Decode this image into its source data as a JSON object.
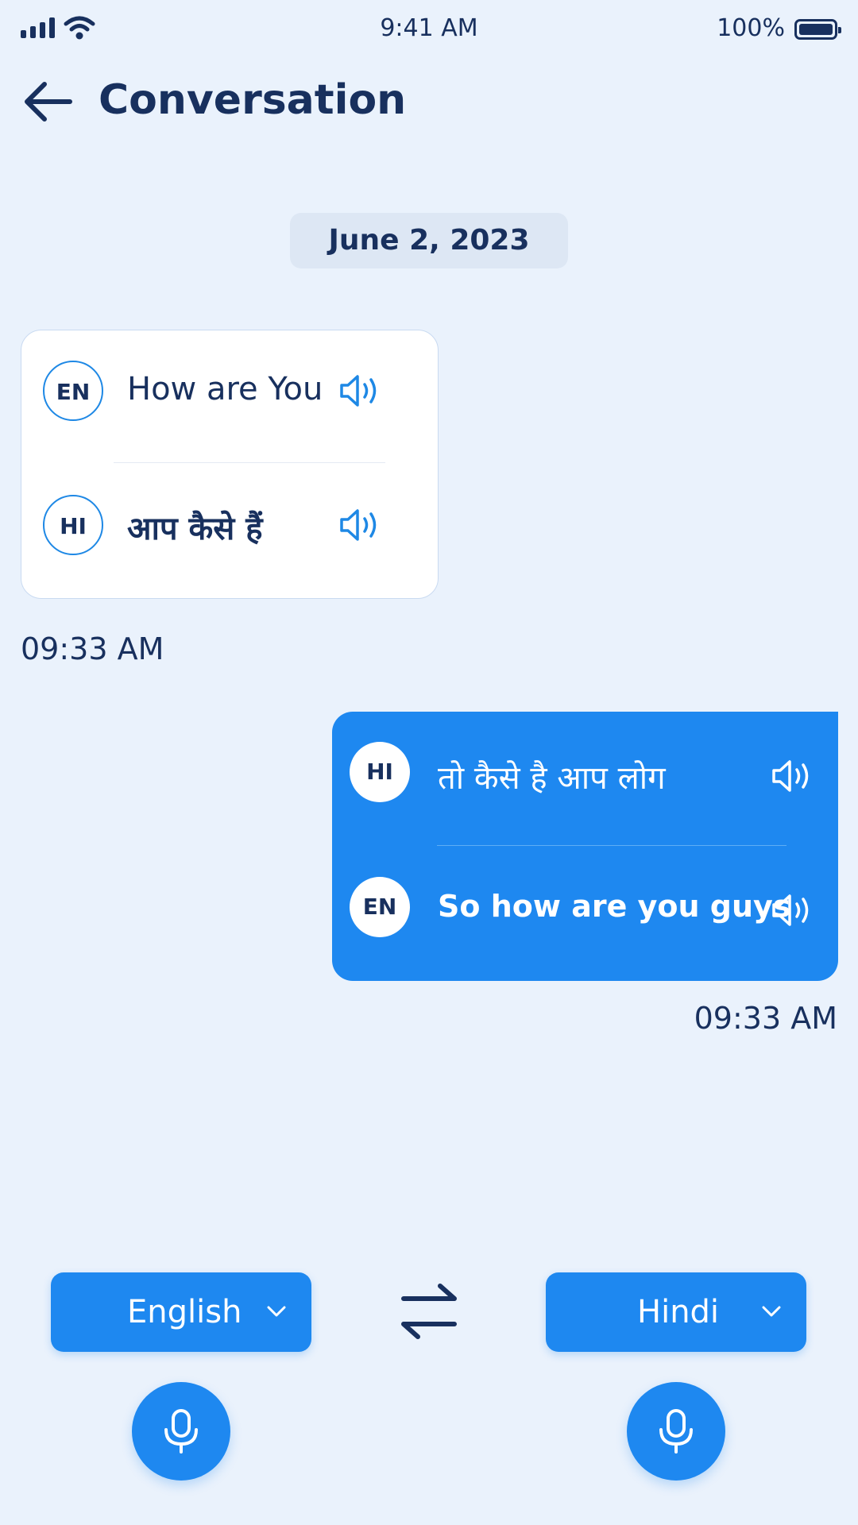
{
  "status_bar": {
    "time": "9:41 AM",
    "battery": "100%"
  },
  "header": {
    "title": "Conversation"
  },
  "date_label": "June 2, 2023",
  "messages": [
    {
      "side": "left",
      "source": {
        "lang_code": "EN",
        "text": "How are You",
        "icon": "speaker-icon"
      },
      "translation": {
        "lang_code": "HI",
        "text": "आप कैसे हैं",
        "icon": "speaker-icon"
      },
      "time": "09:33 AM"
    },
    {
      "side": "right",
      "source": {
        "lang_code": "HI",
        "text": "तो कैसे है आप लोग",
        "icon": "speaker-icon"
      },
      "translation": {
        "lang_code": "EN",
        "text": "So how are you guys",
        "icon": "speaker-icon"
      },
      "time": "09:33 AM"
    }
  ],
  "controls": {
    "left_language": "English",
    "right_language": "Hindi",
    "swap_icon": "swap-arrows-icon",
    "mic_icon": "microphone-icon"
  },
  "colors": {
    "background": "#EAF2FC",
    "primary": "#1E88F0",
    "text": "#18305E",
    "card": "#FFFFFF"
  }
}
